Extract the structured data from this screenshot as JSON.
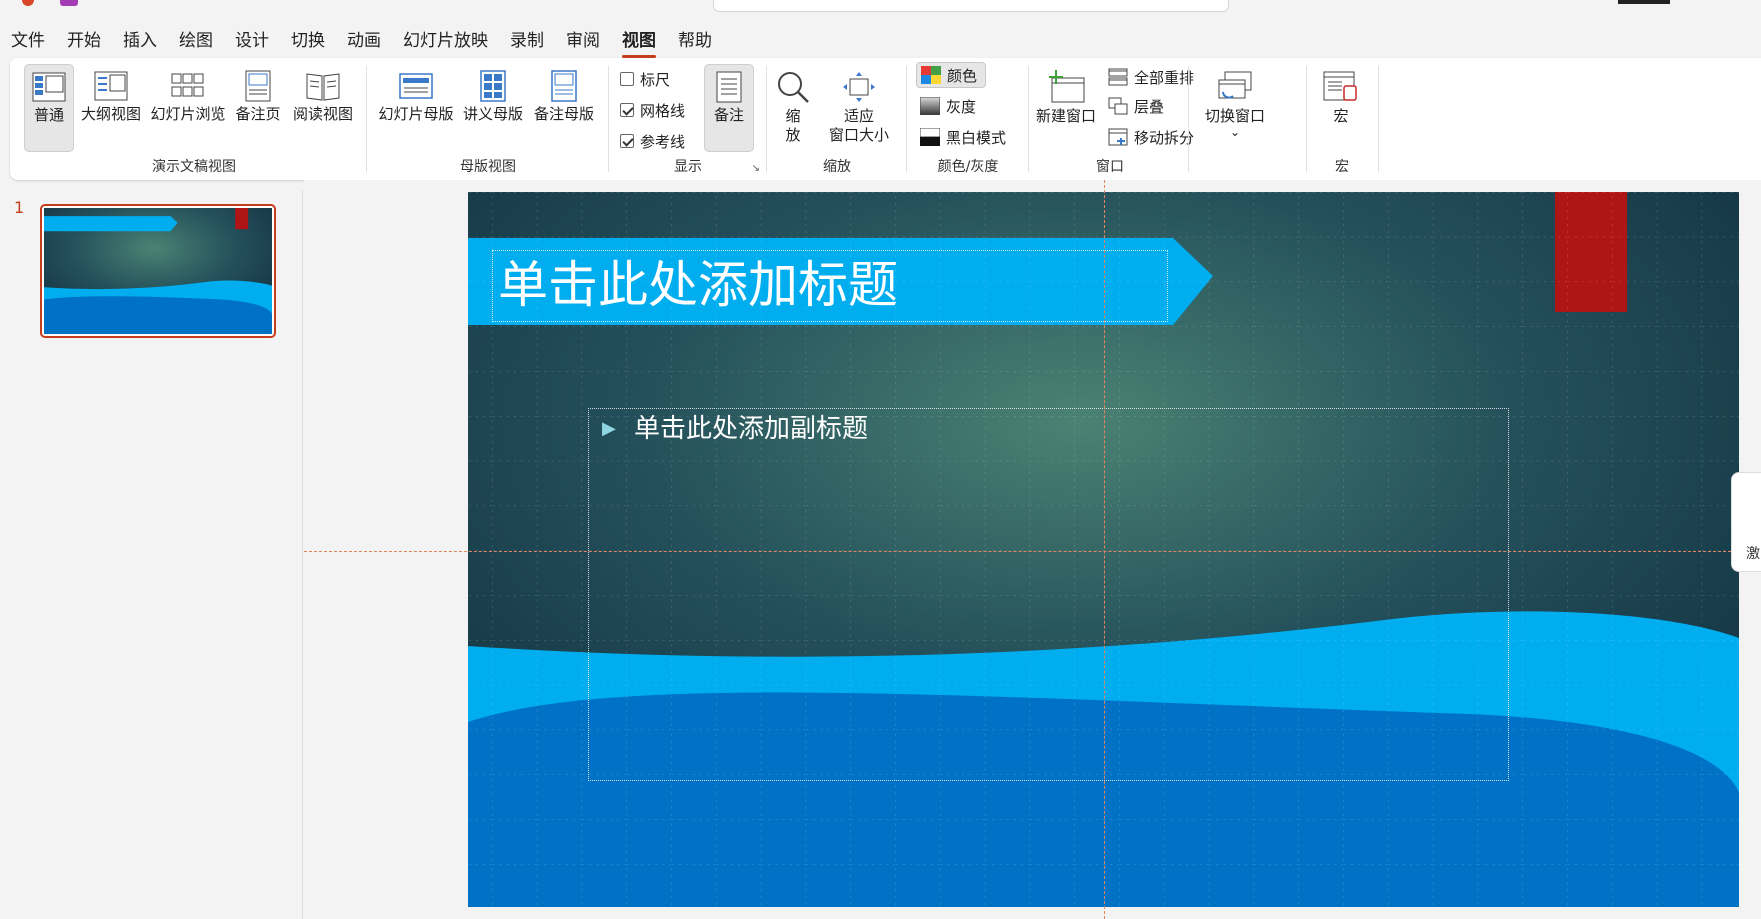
{
  "menu": {
    "tabs": [
      "文件",
      "开始",
      "插入",
      "绘图",
      "设计",
      "切换",
      "动画",
      "幻灯片放映",
      "录制",
      "审阅",
      "视图",
      "帮助"
    ],
    "active_tab": "视图"
  },
  "ribbon": {
    "presentation_views": {
      "label": "演示文稿视图",
      "buttons": [
        "普通",
        "大纲视图",
        "幻灯片浏览",
        "备注页",
        "阅读视图"
      ]
    },
    "master_views": {
      "label": "母版视图",
      "buttons": [
        "幻灯片母版",
        "讲义母版",
        "备注母版"
      ]
    },
    "show": {
      "label": "显示",
      "ruler": "标尺",
      "ruler_checked": false,
      "gridlines": "网格线",
      "gridlines_checked": true,
      "guides": "参考线",
      "guides_checked": true,
      "notes": "备注"
    },
    "zoom": {
      "label": "缩放",
      "zoom_line1": "缩",
      "zoom_line2": "放",
      "fit_line1": "适应",
      "fit_line2": "窗口大小"
    },
    "color": {
      "label": "颜色/灰度",
      "color": "颜色",
      "grayscale": "灰度",
      "bw": "黑白模式"
    },
    "window": {
      "label": "窗口",
      "new_window": "新建窗口",
      "arrange_all": "全部重排",
      "cascade": "层叠",
      "move_split": "移动拆分",
      "switch_window": "切换窗口",
      "switch_caret": "⌄"
    },
    "macros": {
      "label": "宏",
      "button": "宏"
    }
  },
  "thumbnails": {
    "slide_number": "1"
  },
  "slide": {
    "title_placeholder": "单击此处添加标题",
    "subtitle_placeholder": "单击此处添加副标题",
    "bullet": "▶"
  },
  "side_tab": "激",
  "colors": {
    "accent": "#c43e1c",
    "banner": "#00adef",
    "wave_dark": "#0072c6",
    "bg_dark": "#1c3f4c",
    "red_bar": "#b01515"
  }
}
